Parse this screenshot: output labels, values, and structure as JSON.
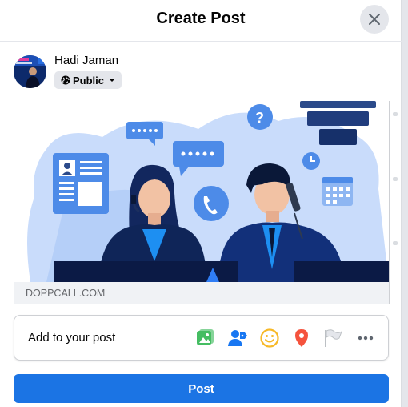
{
  "header": {
    "title": "Create Post",
    "close_icon": "close-icon"
  },
  "user": {
    "name": "Hadi Jaman",
    "avatar": "avatar"
  },
  "privacy": {
    "label": "Public",
    "icon": "globe-icon",
    "caret": "caret-down-icon"
  },
  "link_preview": {
    "domain": "DOPPCALL.COM"
  },
  "add_to_post": {
    "label": "Add to your post",
    "icons": [
      "photo-video-icon",
      "tag-people-icon",
      "feeling-icon",
      "check-in-icon",
      "flag-icon",
      "more-icon"
    ]
  },
  "post_button": {
    "label": "Post"
  },
  "colors": {
    "accent": "#1b74e4",
    "photo": "#45bd62",
    "tag": "#1877f2",
    "feeling": "#f7b928",
    "checkin": "#f5533d"
  }
}
